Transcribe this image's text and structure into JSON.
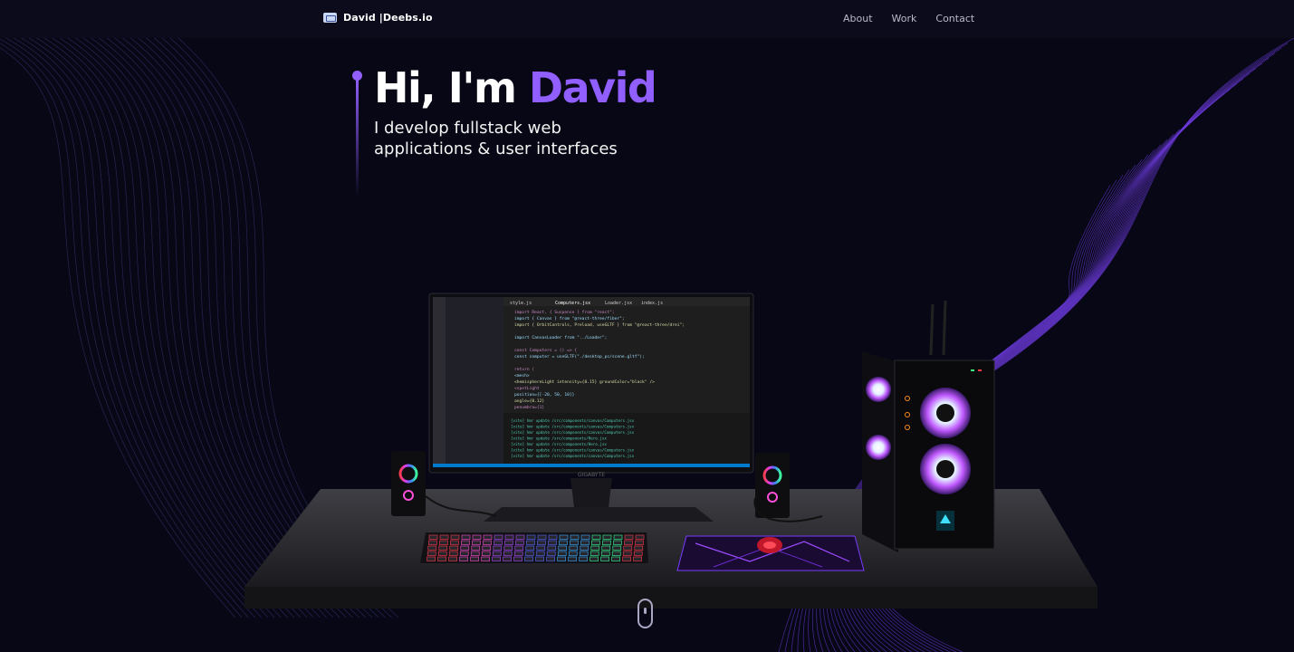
{
  "navbar": {
    "brand": "David  |Deebs.io",
    "links": [
      "About",
      "Work",
      "Contact"
    ]
  },
  "hero": {
    "title_prefix": "Hi, I'm ",
    "title_name": "David",
    "subtitle": "I develop fullstack web applications & user interfaces"
  },
  "scene": {
    "monitor_brand": "GIGABYTE",
    "editor_tabs": [
      "style.js",
      "Computers.jsx",
      "Loader.jsx",
      "index.js"
    ],
    "code_lines": [
      "import React, { Suspense } from \"react\";",
      "import { Canvas } from \"@react-three/fiber\";",
      "import { OrbitControls, Preload, useGLTF } from \"@react-three/drei\";",
      "",
      "import CanvasLoader from \"../Loader\";",
      "",
      "const Computers = () => {",
      "  const computer = useGLTF(\"./desktop_pc/scene.gltf\");",
      "",
      "  return (",
      "    <mesh>",
      "      <hemisphereLight intensity={0.15} groundColor=\"black\" />",
      "      <spotLight",
      "        position={[-20, 50, 10]}",
      "        angle={0.12}",
      "        penumbra={1}"
    ],
    "terminal_lines": [
      "[vite] hmr update /src/components/canvas/Computers.jsx",
      "[vite] hmr update /src/components/canvas/Computers.jsx",
      "[vite] hmr update /src/components/canvas/Computers.jsx",
      "[vite] hmr update /src/components/Hero.jsx",
      "[vite] hmr update /src/components/Hero.jsx",
      "[vite] hmr update /src/components/canvas/Computers.jsx",
      "[vite] hmr update /src/components/canvas/Computers.jsx"
    ]
  },
  "colors": {
    "accent": "#915eff",
    "background": "#070716",
    "navbar": "#0b0b1c"
  },
  "icons": {
    "brand": "logo-icon",
    "scroll": "mouse-scroll-icon"
  }
}
